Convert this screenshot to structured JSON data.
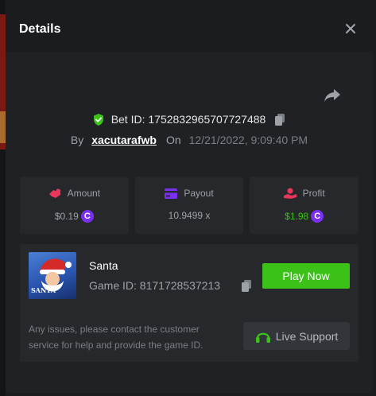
{
  "modal": {
    "title": "Details"
  },
  "bet": {
    "id_label": "Bet ID: 1752832965707727488",
    "by_label": "By",
    "username": "xacutarafwb",
    "on_label": "On",
    "date": "12/21/2022, 9:09:40 PM"
  },
  "stats": {
    "amount_label": "Amount",
    "amount_value": "$0.19",
    "payout_label": "Payout",
    "payout_value": "10.9499 x",
    "profit_label": "Profit",
    "profit_value": "$1.98",
    "coin_symbol": "C"
  },
  "game": {
    "name": "Santa",
    "id_label": "Game ID: 8171728537213",
    "thumb_text": "SANTA",
    "play_label": "Play Now",
    "issues_text": "Any issues, please contact the customer service for help and provide the game ID.",
    "support_label": "Live Support"
  },
  "colors": {
    "accent_green": "#3bc117",
    "profit_green": "#3bc117",
    "coin_purple": "#7b2ff0",
    "amount_icon": "#e8375a",
    "payout_icon": "#7b2ff0",
    "profit_icon": "#e8375a",
    "shield_green": "#3bc117"
  },
  "icons": {
    "close": "close-icon",
    "share": "share-icon",
    "shield": "shield-check-icon",
    "copy": "copy-icon",
    "amount": "amount-icon",
    "payout": "card-icon",
    "profit": "profit-icon",
    "headset": "headset-icon"
  }
}
